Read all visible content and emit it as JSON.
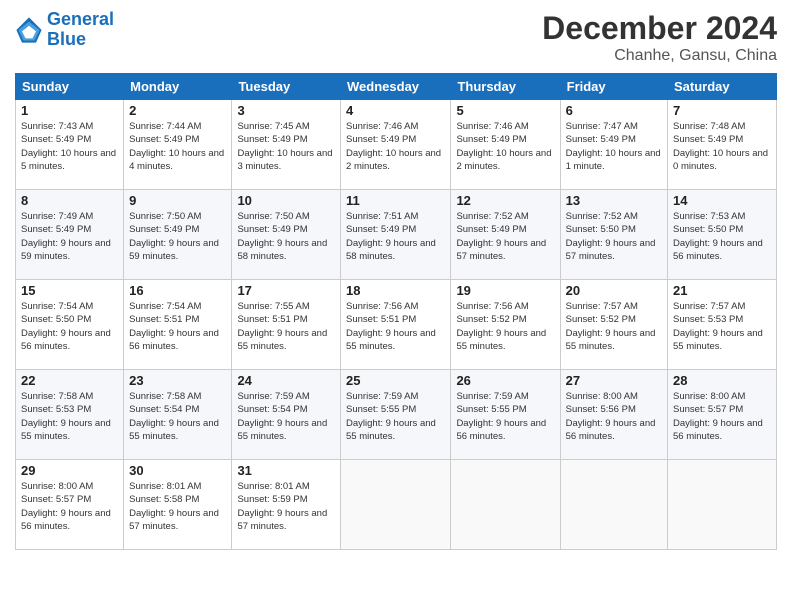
{
  "logo": {
    "line1": "General",
    "line2": "Blue"
  },
  "title": "December 2024",
  "location": "Chanhe, Gansu, China",
  "weekdays": [
    "Sunday",
    "Monday",
    "Tuesday",
    "Wednesday",
    "Thursday",
    "Friday",
    "Saturday"
  ],
  "weeks": [
    [
      {
        "day": "1",
        "sunrise": "Sunrise: 7:43 AM",
        "sunset": "Sunset: 5:49 PM",
        "daylight": "Daylight: 10 hours and 5 minutes."
      },
      {
        "day": "2",
        "sunrise": "Sunrise: 7:44 AM",
        "sunset": "Sunset: 5:49 PM",
        "daylight": "Daylight: 10 hours and 4 minutes."
      },
      {
        "day": "3",
        "sunrise": "Sunrise: 7:45 AM",
        "sunset": "Sunset: 5:49 PM",
        "daylight": "Daylight: 10 hours and 3 minutes."
      },
      {
        "day": "4",
        "sunrise": "Sunrise: 7:46 AM",
        "sunset": "Sunset: 5:49 PM",
        "daylight": "Daylight: 10 hours and 2 minutes."
      },
      {
        "day": "5",
        "sunrise": "Sunrise: 7:46 AM",
        "sunset": "Sunset: 5:49 PM",
        "daylight": "Daylight: 10 hours and 2 minutes."
      },
      {
        "day": "6",
        "sunrise": "Sunrise: 7:47 AM",
        "sunset": "Sunset: 5:49 PM",
        "daylight": "Daylight: 10 hours and 1 minute."
      },
      {
        "day": "7",
        "sunrise": "Sunrise: 7:48 AM",
        "sunset": "Sunset: 5:49 PM",
        "daylight": "Daylight: 10 hours and 0 minutes."
      }
    ],
    [
      {
        "day": "8",
        "sunrise": "Sunrise: 7:49 AM",
        "sunset": "Sunset: 5:49 PM",
        "daylight": "Daylight: 9 hours and 59 minutes."
      },
      {
        "day": "9",
        "sunrise": "Sunrise: 7:50 AM",
        "sunset": "Sunset: 5:49 PM",
        "daylight": "Daylight: 9 hours and 59 minutes."
      },
      {
        "day": "10",
        "sunrise": "Sunrise: 7:50 AM",
        "sunset": "Sunset: 5:49 PM",
        "daylight": "Daylight: 9 hours and 58 minutes."
      },
      {
        "day": "11",
        "sunrise": "Sunrise: 7:51 AM",
        "sunset": "Sunset: 5:49 PM",
        "daylight": "Daylight: 9 hours and 58 minutes."
      },
      {
        "day": "12",
        "sunrise": "Sunrise: 7:52 AM",
        "sunset": "Sunset: 5:49 PM",
        "daylight": "Daylight: 9 hours and 57 minutes."
      },
      {
        "day": "13",
        "sunrise": "Sunrise: 7:52 AM",
        "sunset": "Sunset: 5:50 PM",
        "daylight": "Daylight: 9 hours and 57 minutes."
      },
      {
        "day": "14",
        "sunrise": "Sunrise: 7:53 AM",
        "sunset": "Sunset: 5:50 PM",
        "daylight": "Daylight: 9 hours and 56 minutes."
      }
    ],
    [
      {
        "day": "15",
        "sunrise": "Sunrise: 7:54 AM",
        "sunset": "Sunset: 5:50 PM",
        "daylight": "Daylight: 9 hours and 56 minutes."
      },
      {
        "day": "16",
        "sunrise": "Sunrise: 7:54 AM",
        "sunset": "Sunset: 5:51 PM",
        "daylight": "Daylight: 9 hours and 56 minutes."
      },
      {
        "day": "17",
        "sunrise": "Sunrise: 7:55 AM",
        "sunset": "Sunset: 5:51 PM",
        "daylight": "Daylight: 9 hours and 55 minutes."
      },
      {
        "day": "18",
        "sunrise": "Sunrise: 7:56 AM",
        "sunset": "Sunset: 5:51 PM",
        "daylight": "Daylight: 9 hours and 55 minutes."
      },
      {
        "day": "19",
        "sunrise": "Sunrise: 7:56 AM",
        "sunset": "Sunset: 5:52 PM",
        "daylight": "Daylight: 9 hours and 55 minutes."
      },
      {
        "day": "20",
        "sunrise": "Sunrise: 7:57 AM",
        "sunset": "Sunset: 5:52 PM",
        "daylight": "Daylight: 9 hours and 55 minutes."
      },
      {
        "day": "21",
        "sunrise": "Sunrise: 7:57 AM",
        "sunset": "Sunset: 5:53 PM",
        "daylight": "Daylight: 9 hours and 55 minutes."
      }
    ],
    [
      {
        "day": "22",
        "sunrise": "Sunrise: 7:58 AM",
        "sunset": "Sunset: 5:53 PM",
        "daylight": "Daylight: 9 hours and 55 minutes."
      },
      {
        "day": "23",
        "sunrise": "Sunrise: 7:58 AM",
        "sunset": "Sunset: 5:54 PM",
        "daylight": "Daylight: 9 hours and 55 minutes."
      },
      {
        "day": "24",
        "sunrise": "Sunrise: 7:59 AM",
        "sunset": "Sunset: 5:54 PM",
        "daylight": "Daylight: 9 hours and 55 minutes."
      },
      {
        "day": "25",
        "sunrise": "Sunrise: 7:59 AM",
        "sunset": "Sunset: 5:55 PM",
        "daylight": "Daylight: 9 hours and 55 minutes."
      },
      {
        "day": "26",
        "sunrise": "Sunrise: 7:59 AM",
        "sunset": "Sunset: 5:55 PM",
        "daylight": "Daylight: 9 hours and 56 minutes."
      },
      {
        "day": "27",
        "sunrise": "Sunrise: 8:00 AM",
        "sunset": "Sunset: 5:56 PM",
        "daylight": "Daylight: 9 hours and 56 minutes."
      },
      {
        "day": "28",
        "sunrise": "Sunrise: 8:00 AM",
        "sunset": "Sunset: 5:57 PM",
        "daylight": "Daylight: 9 hours and 56 minutes."
      }
    ],
    [
      {
        "day": "29",
        "sunrise": "Sunrise: 8:00 AM",
        "sunset": "Sunset: 5:57 PM",
        "daylight": "Daylight: 9 hours and 56 minutes."
      },
      {
        "day": "30",
        "sunrise": "Sunrise: 8:01 AM",
        "sunset": "Sunset: 5:58 PM",
        "daylight": "Daylight: 9 hours and 57 minutes."
      },
      {
        "day": "31",
        "sunrise": "Sunrise: 8:01 AM",
        "sunset": "Sunset: 5:59 PM",
        "daylight": "Daylight: 9 hours and 57 minutes."
      },
      null,
      null,
      null,
      null
    ]
  ]
}
